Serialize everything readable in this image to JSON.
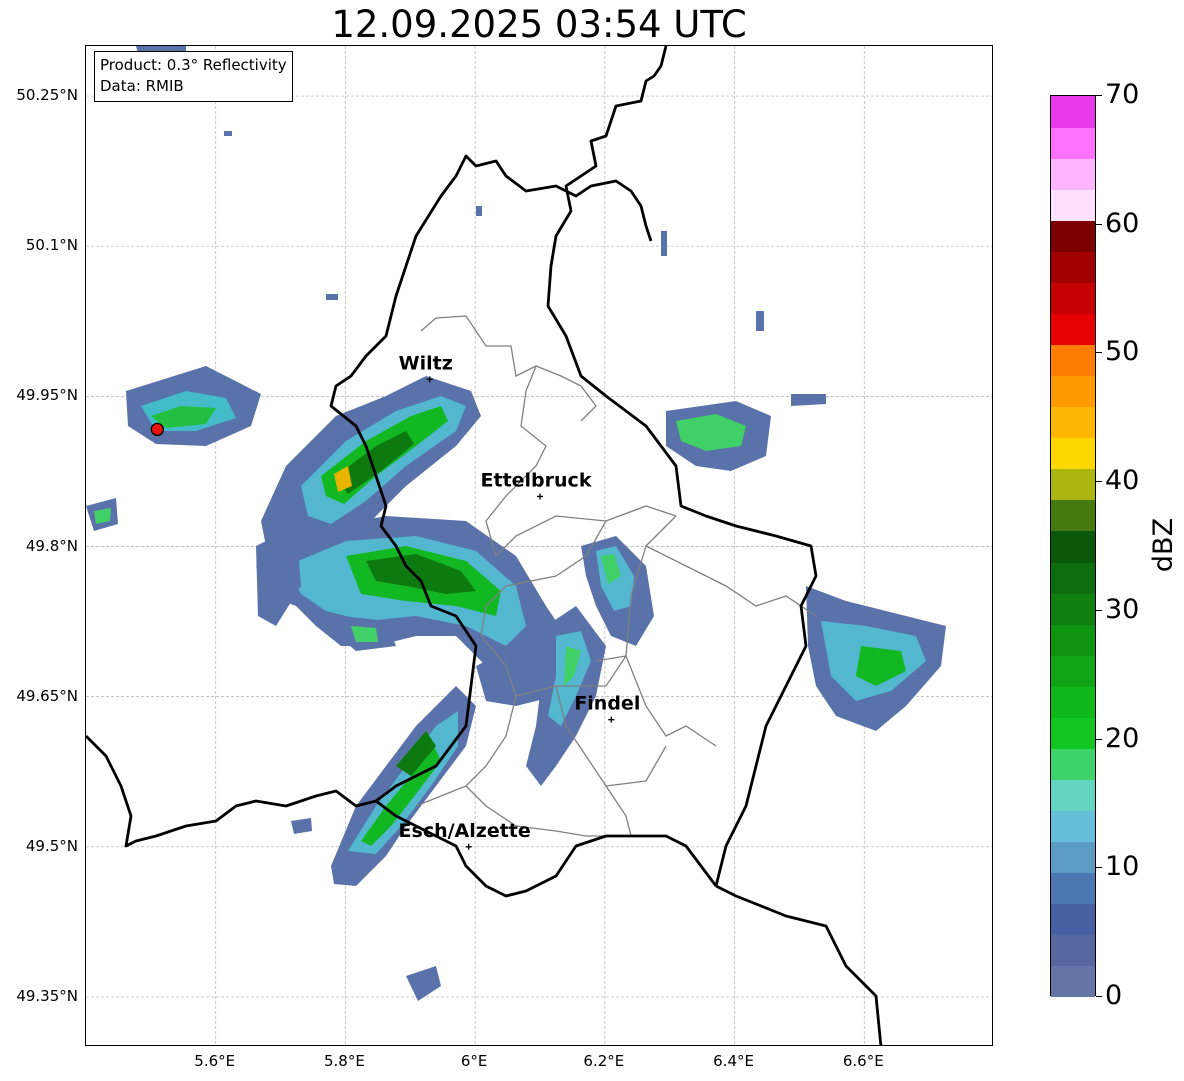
{
  "title": "12.09.2025 03:54 UTC",
  "info_box": {
    "product": "Product: 0.3° Reflectivity",
    "data": "Data: RMIB"
  },
  "axes": {
    "lat_labels": [
      "50.25°N",
      "50.1°N",
      "49.95°N",
      "49.8°N",
      "49.65°N",
      "49.5°N",
      "49.35°N"
    ],
    "lat_values": [
      50.25,
      50.1,
      49.95,
      49.8,
      49.65,
      49.5,
      49.35
    ],
    "lon_labels": [
      "5.6°E",
      "5.8°E",
      "6°E",
      "6.2°E",
      "6.4°E",
      "6.6°E"
    ],
    "lon_values": [
      5.6,
      5.8,
      6.0,
      6.2,
      6.4,
      6.6
    ],
    "lon_range": [
      5.4,
      6.8
    ],
    "lat_range": [
      49.3,
      50.3
    ],
    "grid": true
  },
  "cities": [
    {
      "name": "Wiltz",
      "lon": 5.93,
      "lat": 49.967
    },
    {
      "name": "Ettelbruck",
      "lon": 6.1,
      "lat": 49.85
    },
    {
      "name": "Findel",
      "lon": 6.21,
      "lat": 49.627
    },
    {
      "name": "Esch/Alzette",
      "lon": 5.99,
      "lat": 49.5
    }
  ],
  "radar_site": {
    "lon": 5.51,
    "lat": 49.917,
    "color": "#e8150f"
  },
  "colorbar": {
    "label": "dBZ",
    "min": 0,
    "max": 70,
    "tick_labels": [
      "0",
      "10",
      "20",
      "30",
      "40",
      "50",
      "60",
      "70"
    ],
    "tick_values": [
      0,
      10,
      20,
      30,
      40,
      50,
      60,
      70
    ],
    "colors": [
      "#6675a8",
      "#5667a0",
      "#4560a3",
      "#4b78b0",
      "#5c9cc4",
      "#66bfda",
      "#62d4c0",
      "#3ed36a",
      "#12c520",
      "#10b81a",
      "#10a514",
      "#0f9412",
      "#0e7f10",
      "#0d6c0e",
      "#0b580b",
      "#457a10",
      "#aab510",
      "#ffd600",
      "#ffb600",
      "#ff9b00",
      "#ff7d00",
      "#e60000",
      "#c40000",
      "#a20000",
      "#7d0000",
      "#ffe0ff",
      "#ffb4ff",
      "#ff70ff",
      "#e83ae8"
    ]
  }
}
